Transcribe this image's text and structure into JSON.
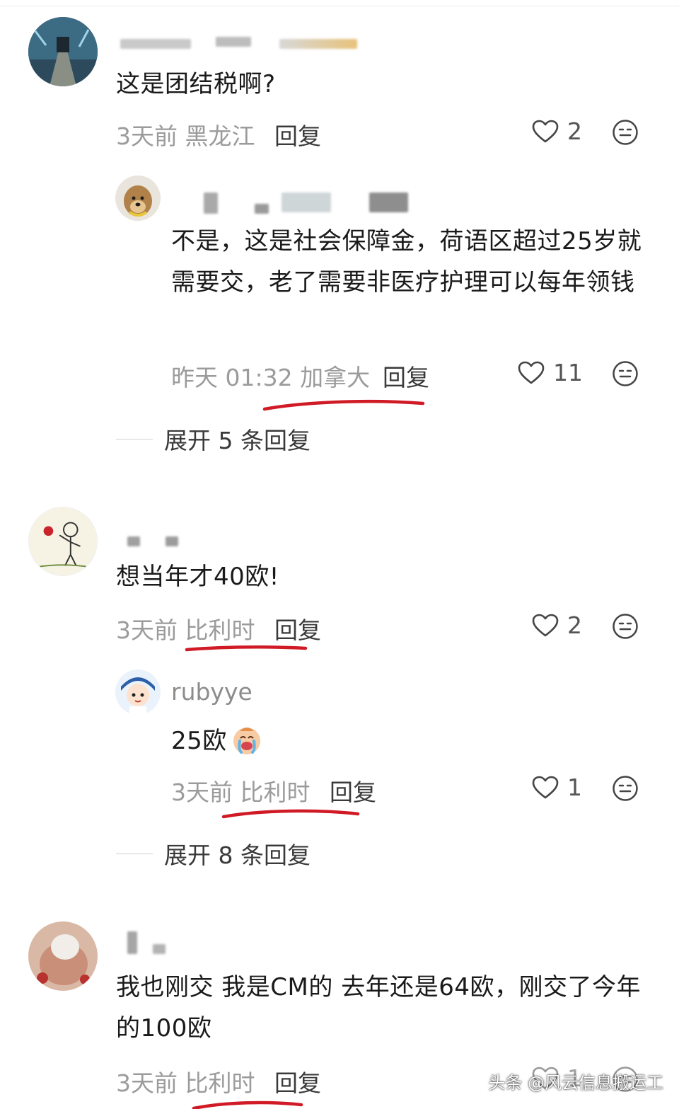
{
  "comments": [
    {
      "text": "这是团结税啊?",
      "meta": "3天前 黑龙江",
      "reply_label": "回复",
      "likes": "2",
      "replies": [
        {
          "text": "不是，这是社会保障金，荷语区超过25岁就需要交，老了需要非医疗护理可以每年领钱",
          "meta": "昨天 01:32 加拿大",
          "reply_label": "回复",
          "likes": "11"
        }
      ],
      "expand_label": "展开 5 条回复"
    },
    {
      "text": "想当年才40欧!",
      "meta": "3天前 比利时",
      "reply_label": "回复",
      "likes": "2",
      "replies": [
        {
          "username": "rubyye",
          "text": "25欧",
          "meta": "3天前 比利时",
          "reply_label": "回复",
          "likes": "1"
        }
      ],
      "expand_label": "展开 8 条回复"
    },
    {
      "text": "我也刚交 我是CM的 去年还是64欧，刚交了今年的100欧",
      "meta": "3天前 比利时",
      "reply_label": "回复",
      "likes": "1"
    }
  ],
  "watermark": "头条 @风云信息搬运工",
  "colors": {
    "annotation_red": "#d01a26",
    "meta_gray": "#9b9b9b"
  },
  "icons": [
    "heart-outline-icon",
    "emoji-face-icon",
    "crying-emoji-icon"
  ]
}
